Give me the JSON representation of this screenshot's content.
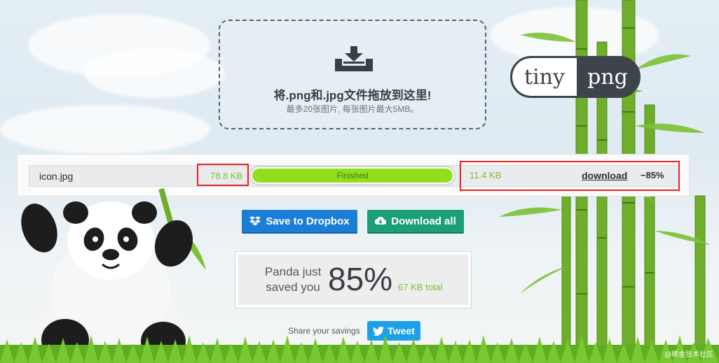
{
  "dropzone": {
    "title": "将.png和.jpg文件拖放到这里!",
    "subtitle": "最多20张图片, 每张图片最大5MB。",
    "icon": "download-tray-icon"
  },
  "logo": {
    "left": "tiny",
    "right": "png"
  },
  "results": {
    "file": {
      "name": "icon.jpg",
      "original_size": "78.8 KB",
      "status": "Finished",
      "progress": 1.0,
      "new_size": "11.4 KB",
      "download_label": "download",
      "reduction": "−85%"
    }
  },
  "actions": {
    "dropbox_label": "Save to Dropbox",
    "download_all_label": "Download all"
  },
  "savings": {
    "text": "Panda just saved you",
    "percent": "85%",
    "total": "67 KB total"
  },
  "share": {
    "label": "Share your savings",
    "tweet_label": "Tweet"
  },
  "watermark": "@稀金技术社区",
  "colors": {
    "accent_green": "#8fe01a",
    "dropbox_blue": "#1b7ed6",
    "download_green": "#1ba076",
    "twitter_blue": "#1da1e6",
    "highlight_red": "#e5222a"
  }
}
